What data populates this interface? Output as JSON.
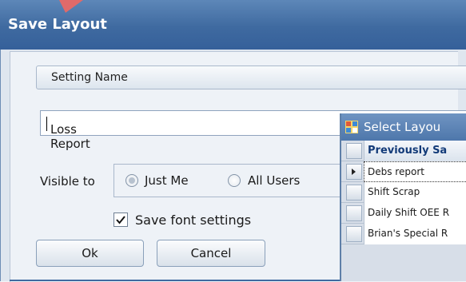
{
  "dialog": {
    "title": "Save Layout",
    "group_header": "Setting Name",
    "name_value": "Loss Report",
    "visible_to_label": "Visible to",
    "options": [
      {
        "label": "Just Me",
        "selected": true
      },
      {
        "label": "All Users",
        "selected": false
      }
    ],
    "save_font_label": "Save font settings",
    "save_font_checked": true,
    "ok_label": "Ok",
    "cancel_label": "Cancel"
  },
  "select_layout": {
    "title": "Select Layou",
    "header": "Previously Sa",
    "rows": [
      {
        "label": "Debs report",
        "current": true
      },
      {
        "label": "Shift Scrap",
        "current": false
      },
      {
        "label": "Daily Shift OEE R",
        "current": false
      },
      {
        "label": "Brian's Special R",
        "current": false
      }
    ]
  },
  "colors": {
    "title_bar": "#3f6aa0",
    "header_text": "#123a78",
    "arrow_accent": "#e06a6a"
  },
  "icons": {
    "arrow": "pointer-arrow-icon",
    "window": "window-grid-icon",
    "check": "checkmark-icon",
    "row_indicator": "row-pointer-icon"
  }
}
